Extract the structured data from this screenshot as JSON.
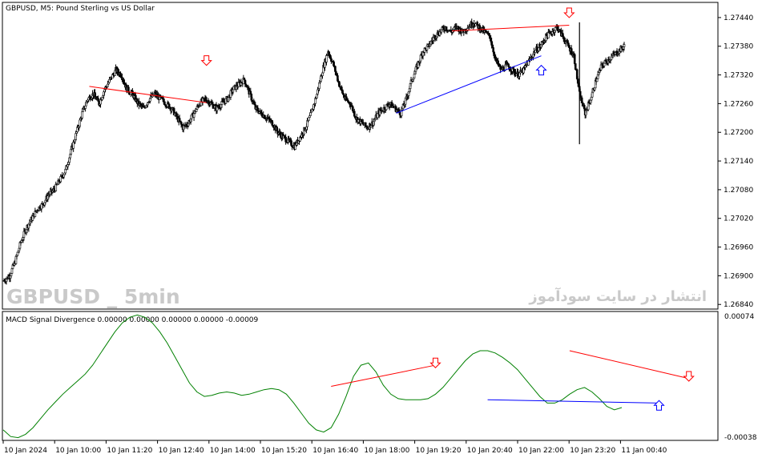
{
  "window": {
    "symbol_title": "GBPUSD, M5:  Pound Sterling vs US Dollar",
    "watermark_left": "GBPUSD _ 5min",
    "watermark_right": "انتشار در سایت سودآموز"
  },
  "indicator": {
    "title": "MACD Signal Divergence 0.00000 0.00000 0.00000 0.00000 -0.00009",
    "scale_top": "0.00074",
    "scale_bottom": "-0.00038"
  },
  "colors": {
    "bearish_line": "#ff0000",
    "bullish_line": "#0000ff",
    "macd_line": "#008000",
    "candles": "#000000"
  },
  "icons": {
    "bearish_arrow": "down-arrow-icon",
    "bullish_arrow": "up-arrow-icon"
  },
  "chart_data": {
    "type": "candlestick",
    "price_ticks": [
      "1.27440",
      "1.27380",
      "1.27320",
      "1.27260",
      "1.27200",
      "1.27140",
      "1.27080",
      "1.27020",
      "1.26960",
      "1.26900",
      "1.26840"
    ],
    "time_labels": [
      "10 Jan 2024",
      "10 Jan 10:00",
      "10 Jan 11:20",
      "10 Jan 12:40",
      "10 Jan 14:00",
      "10 Jan 15:20",
      "10 Jan 16:40",
      "10 Jan 18:00",
      "10 Jan 19:20",
      "10 Jan 20:40",
      "10 Jan 22:00",
      "10 Jan 23:20",
      "11 Jan 00:40"
    ],
    "price_range": [
      1.26832,
      1.2747
    ],
    "close_path": [
      1.2689,
      1.269,
      1.2693,
      1.2697,
      1.27,
      1.2702,
      1.2704,
      1.2705,
      1.2707,
      1.2708,
      1.271,
      1.2712,
      1.2716,
      1.272,
      1.2724,
      1.2727,
      1.2728,
      1.2726,
      1.2729,
      1.2731,
      1.2733,
      1.2732,
      1.2729,
      1.2728,
      1.2726,
      1.2725,
      1.2727,
      1.2728,
      1.2727,
      1.2726,
      1.2725,
      1.2723,
      1.2721,
      1.2722,
      1.2724,
      1.2726,
      1.2727,
      1.2726,
      1.2725,
      1.2726,
      1.2727,
      1.2729,
      1.273,
      1.2731,
      1.2728,
      1.2725,
      1.2724,
      1.2723,
      1.2722,
      1.272,
      1.2719,
      1.2718,
      1.2717,
      1.2719,
      1.2721,
      1.2724,
      1.2728,
      1.2733,
      1.2737,
      1.2734,
      1.273,
      1.2727,
      1.2726,
      1.2723,
      1.2722,
      1.2721,
      1.2722,
      1.2724,
      1.2725,
      1.2726,
      1.2725,
      1.2724,
      1.2727,
      1.2731,
      1.2734,
      1.2737,
      1.2738,
      1.274,
      1.2741,
      1.2742,
      1.2741,
      1.2742,
      1.2741,
      1.2742,
      1.2743,
      1.2742,
      1.2741,
      1.274,
      1.2735,
      1.2733,
      1.2734,
      1.2733,
      1.2732,
      1.2733,
      1.2735,
      1.2737,
      1.2738,
      1.274,
      1.2741,
      1.2742,
      1.274,
      1.2738,
      1.2736,
      1.2728,
      1.2724,
      1.2727,
      1.2731,
      1.2734,
      1.2735,
      1.2736,
      1.2737,
      1.2738
    ],
    "bearish_divergence": {
      "price": [
        {
          "t": 15,
          "v": 1.27296
        },
        {
          "t": 36,
          "v": 1.27262
        }
      ],
      "arrow_at": {
        "t": 36,
        "v": 1.2735
      },
      "price2": [
        {
          "t": 80,
          "v": 1.27412
        },
        {
          "t": 101,
          "v": 1.27424
        }
      ],
      "arrow2_at": {
        "t": 101,
        "v": 1.2745
      }
    },
    "bullish_divergence": {
      "price": [
        {
          "t": 70,
          "v": 1.2724
        },
        {
          "t": 96,
          "v": 1.2736
        }
      ],
      "arrow_at": {
        "t": 96,
        "v": 1.2733
      }
    },
    "macd": {
      "range": [
        -0.00038,
        0.00074
      ],
      "values": [
        -0.0003,
        -0.00036,
        -0.00037,
        -0.00034,
        -0.00028,
        -0.0002,
        -0.00012,
        -5e-05,
        2e-05,
        8e-05,
        0.00014,
        0.0002,
        0.00028,
        0.00038,
        0.00048,
        0.00058,
        0.00066,
        0.00071,
        0.00073,
        0.00071,
        0.00066,
        0.00058,
        0.00048,
        0.00036,
        0.00024,
        0.00012,
        4e-05,
        0.0,
        1e-05,
        3e-05,
        4e-05,
        3e-05,
        1e-05,
        2e-05,
        4e-05,
        6e-05,
        7e-05,
        6e-05,
        2e-05,
        -6e-05,
        -0.00015,
        -0.00024,
        -0.0003,
        -0.00032,
        -0.00028,
        -0.00016,
        0.0,
        0.00018,
        0.00028,
        0.0003,
        0.00022,
        0.0001,
        2e-05,
        -2e-05,
        -3e-05,
        -3e-05,
        -3e-05,
        -2e-05,
        2e-05,
        8e-05,
        0.00016,
        0.00024,
        0.00032,
        0.00038,
        0.00041,
        0.00041,
        0.00039,
        0.00035,
        0.0003,
        0.00024,
        0.00016,
        8e-05,
        0.0,
        -6e-05,
        -6e-05,
        -3e-05,
        2e-05,
        6e-05,
        8e-05,
        4e-05,
        -2e-05,
        -9e-05,
        -0.00012,
        -0.0001
      ],
      "bearish_line": [
        {
          "i": 44,
          "v": 9e-05
        },
        {
          "i": 58,
          "v": 0.00028
        }
      ],
      "bearish_arrow": {
        "i": 58,
        "v": 0.0003
      },
      "bearish_line2": [
        {
          "i": 76,
          "v": 0.00041
        },
        {
          "i": 92,
          "v": 0.00016
        }
      ],
      "bearish_arrow2": {
        "i": 92,
        "v": 0.00018
      },
      "bullish_line": [
        {
          "i": 65,
          "v": -3e-05
        },
        {
          "i": 88,
          "v": -6e-05
        }
      ],
      "bullish_arrow": {
        "i": 88,
        "v": -8e-05
      }
    }
  }
}
